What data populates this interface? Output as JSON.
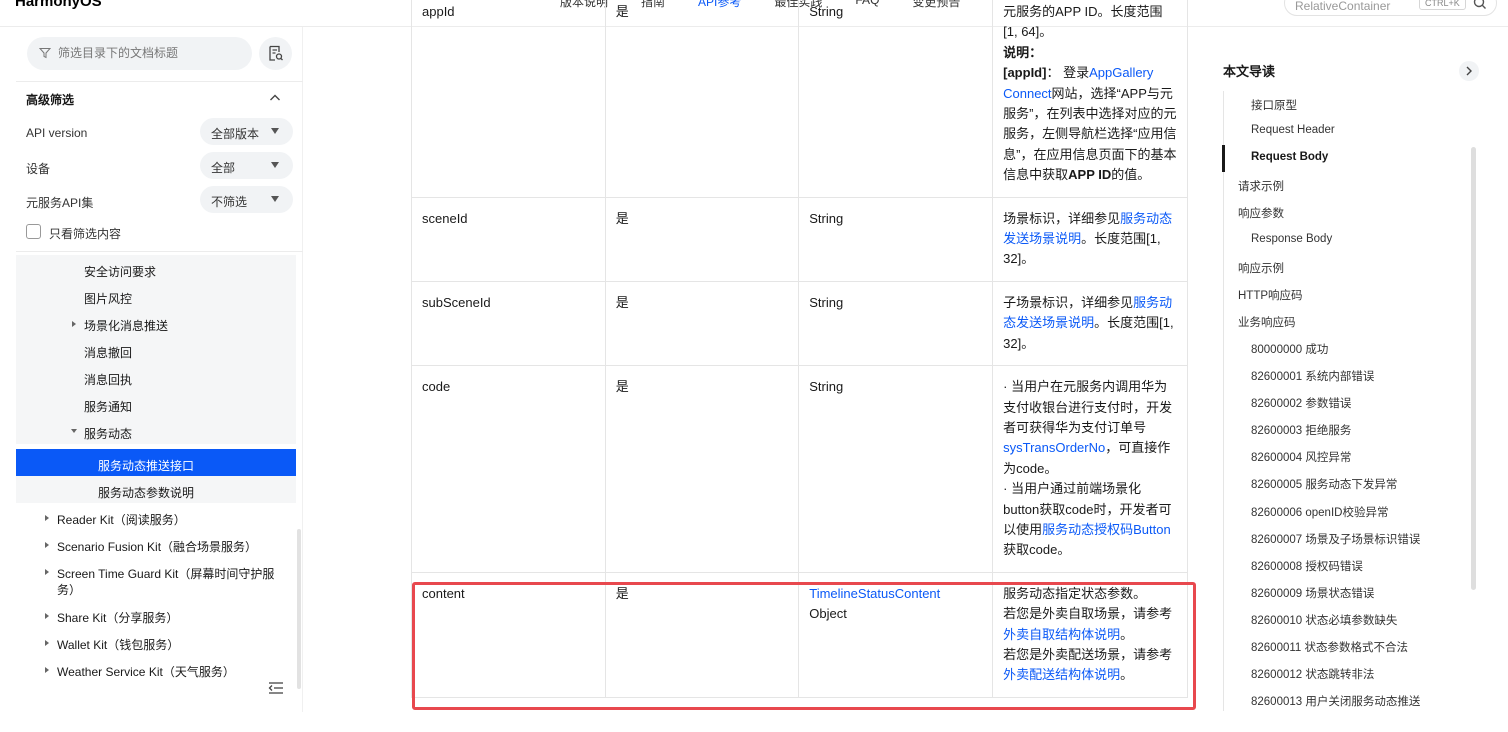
{
  "header": {
    "logo": "HarmonyOS",
    "nav": [
      "版本说明",
      "指南",
      "API参考",
      "最佳实践",
      "FAQ",
      "变更预告"
    ],
    "active_nav": "API参考",
    "search_value": "RelativeContainer",
    "shortcut": "CTRL+K"
  },
  "sidebar": {
    "filter_placeholder": "筛选目录下的文档标题",
    "advanced_title": "高级筛选",
    "filters": [
      {
        "label": "API version",
        "value": "全部版本"
      },
      {
        "label": "设备",
        "value": "全部"
      },
      {
        "label": "元服务API集",
        "value": "不筛选"
      }
    ],
    "only_filtered_label": "只看筛选内容",
    "tree": [
      {
        "label": "安全访问要求",
        "level": 3,
        "state": "none"
      },
      {
        "label": "图片风控",
        "level": 3,
        "state": "none"
      },
      {
        "label": "场景化消息推送",
        "level": 3,
        "state": "collapsed"
      },
      {
        "label": "消息撤回",
        "level": 3,
        "state": "none"
      },
      {
        "label": "消息回执",
        "level": 3,
        "state": "none"
      },
      {
        "label": "服务通知",
        "level": 3,
        "state": "none"
      },
      {
        "label": "服务动态",
        "level": 3,
        "state": "expanded"
      },
      {
        "label": "服务动态推送接口",
        "level": 4,
        "state": "selected"
      },
      {
        "label": "服务动态参数说明",
        "level": 4,
        "state": "none"
      },
      {
        "label": "Reader Kit（阅读服务）",
        "level": 1,
        "state": "collapsed"
      },
      {
        "label": "Scenario Fusion Kit（融合场景服务）",
        "level": 1,
        "state": "collapsed"
      },
      {
        "label": "Screen Time Guard Kit（屏幕时间守护服",
        "label2": "务）",
        "level": 1,
        "state": "collapsed"
      },
      {
        "label": "Share Kit（分享服务）",
        "level": 1,
        "state": "collapsed"
      },
      {
        "label": "Wallet Kit（钱包服务）",
        "level": 1,
        "state": "collapsed"
      },
      {
        "label": "Weather Service Kit（天气服务）",
        "level": 1,
        "state": "collapsed"
      }
    ]
  },
  "table": {
    "rows": [
      {
        "name": "appId",
        "required": "是",
        "type": "String",
        "desc_parts": [
          {
            "t": "元服务的APP ID。长度范围"
          },
          {
            "t": "[1, 64]。",
            "br_before": true
          },
          {
            "t": "说明：",
            "bold": true,
            "br_before": true
          },
          {
            "t": "[appId]",
            "bold": true,
            "br_before": true
          },
          {
            "t": "： 登录"
          },
          {
            "t": "AppGallery Connect",
            "link": true
          },
          {
            "t": "网站，选择“APP与元服务”，在列表中选择对应的元服务，左侧导航栏选择“应用信息”，在应用信息页面下的基本信息中获取"
          },
          {
            "t": "APP ID",
            "bold": true
          },
          {
            "t": "的值。"
          }
        ]
      },
      {
        "name": "sceneId",
        "required": "是",
        "type": "String",
        "desc_parts": [
          {
            "t": "场景标识，详细参见"
          },
          {
            "t": "服务动态发送场景说明",
            "link": true
          },
          {
            "t": "。长度范围[1, 32]。"
          }
        ]
      },
      {
        "name": "subSceneId",
        "required": "是",
        "type": "String",
        "desc_parts": [
          {
            "t": "子场景标识，详细参见"
          },
          {
            "t": "服务动态发送场景说明",
            "link": true
          },
          {
            "t": "。长度范围[1, 32]。"
          }
        ]
      },
      {
        "name": "code",
        "required": "是",
        "type": "String",
        "desc_parts": [
          {
            "t": "· 当用户在元服务内调用华为支付收银台进行支付时，开发者可获得华为支付订单号"
          },
          {
            "t": "sysTransOrderNo",
            "link": true
          },
          {
            "t": "，可直接作为code。"
          },
          {
            "t": "· 当用户通过前端场景化button获取code时，开发者可以使用",
            "br_before": true
          },
          {
            "t": "服务动态授权码Button",
            "link": true
          },
          {
            "t": "获取code。"
          }
        ]
      },
      {
        "name": "content",
        "required": "是",
        "type": "TimelineStatusContent",
        "type_link": true,
        "type_suffix": "Object",
        "desc_parts": [
          {
            "t": "服务动态指定状态参数。"
          },
          {
            "t": "若您是外卖自取场景，请参考",
            "br_before": true
          },
          {
            "t": "外卖自取结构体说明",
            "link": true
          },
          {
            "t": "。"
          },
          {
            "t": "若您是外卖配送场景，请参考",
            "br_before": true
          },
          {
            "t": "外卖配送结构体说明",
            "link": true
          },
          {
            "t": "。"
          }
        ]
      }
    ]
  },
  "toc": {
    "title": "本文导读",
    "items": [
      {
        "label": "接口原型",
        "indent": 1
      },
      {
        "label": "Request Header",
        "indent": 1
      },
      {
        "label": "Request Body",
        "indent": 1,
        "active": true
      },
      {
        "label": "请求示例",
        "indent": 0
      },
      {
        "label": "响应参数",
        "indent": 0
      },
      {
        "label": "Response Body",
        "indent": 1
      },
      {
        "label": "响应示例",
        "indent": 0
      },
      {
        "label": "HTTP响应码",
        "indent": 0
      },
      {
        "label": "业务响应码",
        "indent": 0
      },
      {
        "label": "80000000 成功",
        "indent": 1
      },
      {
        "label": "82600001 系统内部错误",
        "indent": 1
      },
      {
        "label": "82600002 参数错误",
        "indent": 1
      },
      {
        "label": "82600003 拒绝服务",
        "indent": 1
      },
      {
        "label": "82600004 风控异常",
        "indent": 1
      },
      {
        "label": "82600005 服务动态下发异常",
        "indent": 1
      },
      {
        "label": "82600006 openID校验异常",
        "indent": 1
      },
      {
        "label": "82600007 场景及子场景标识错误",
        "indent": 1
      },
      {
        "label": "82600008 授权码错误",
        "indent": 1
      },
      {
        "label": "82600009 场景状态错误",
        "indent": 1
      },
      {
        "label": "82600010 状态必填参数缺失",
        "indent": 1
      },
      {
        "label": "82600011 状态参数格式不合法",
        "indent": 1
      },
      {
        "label": "82600012 状态跳转非法",
        "indent": 1
      },
      {
        "label": "82600013 用户关闭服务动态推送",
        "indent": 1
      }
    ]
  },
  "colors": {
    "accent": "#0a59f7",
    "highlight_border": "#e8484e"
  }
}
